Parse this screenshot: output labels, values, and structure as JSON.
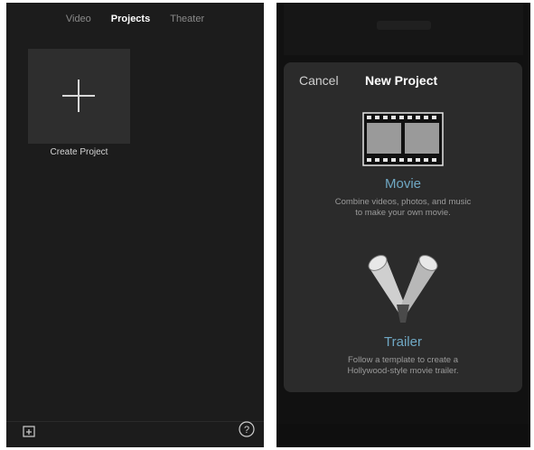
{
  "left_screen": {
    "tabs": [
      {
        "label": "Video",
        "active": false
      },
      {
        "label": "Projects",
        "active": true
      },
      {
        "label": "Theater",
        "active": false
      }
    ],
    "create_project_label": "Create Project",
    "bottom_bar": {
      "import_icon": "import-icon",
      "help_label": "?"
    }
  },
  "right_screen": {
    "modal": {
      "cancel_label": "Cancel",
      "title": "New Project",
      "movie": {
        "title": "Movie",
        "description": "Combine videos, photos, and music to make your own movie.",
        "icon": "film-strip-icon"
      },
      "trailer": {
        "title": "Trailer",
        "description": "Follow a template to create a Hollywood-style movie trailer.",
        "icon": "spotlights-icon"
      }
    }
  },
  "colors": {
    "background": "#1c1c1c",
    "modal": "#2b2b2b",
    "accent": "#6fa8c4"
  }
}
